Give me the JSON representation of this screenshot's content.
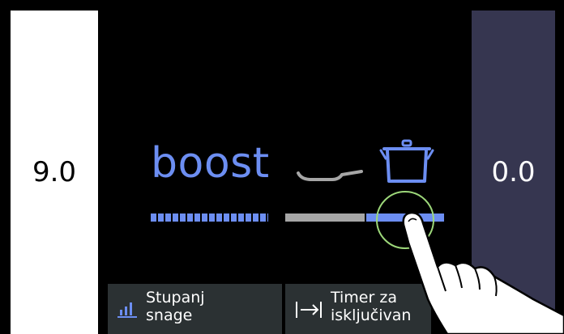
{
  "zones": {
    "left": {
      "value": "9.0"
    },
    "right": {
      "value": "0.0"
    }
  },
  "mode": {
    "label": "boost"
  },
  "icons": {
    "pan": "pan-icon",
    "pot": "pot-icon",
    "power": "power-level-icon",
    "timer": "timer-off-icon",
    "hand": "touch-hand-icon"
  },
  "menu": {
    "power_level": {
      "line1": "Stupanj",
      "line2": "snage"
    },
    "off_timer": {
      "line1": "Timer za",
      "line2": "isključivan"
    }
  },
  "colors": {
    "accent": "#6c8ef2",
    "inactive": "#a6a6a6",
    "touch_ring": "#9dd87a",
    "zone_right_bg": "#363650",
    "tile_bg": "#2b3133"
  }
}
